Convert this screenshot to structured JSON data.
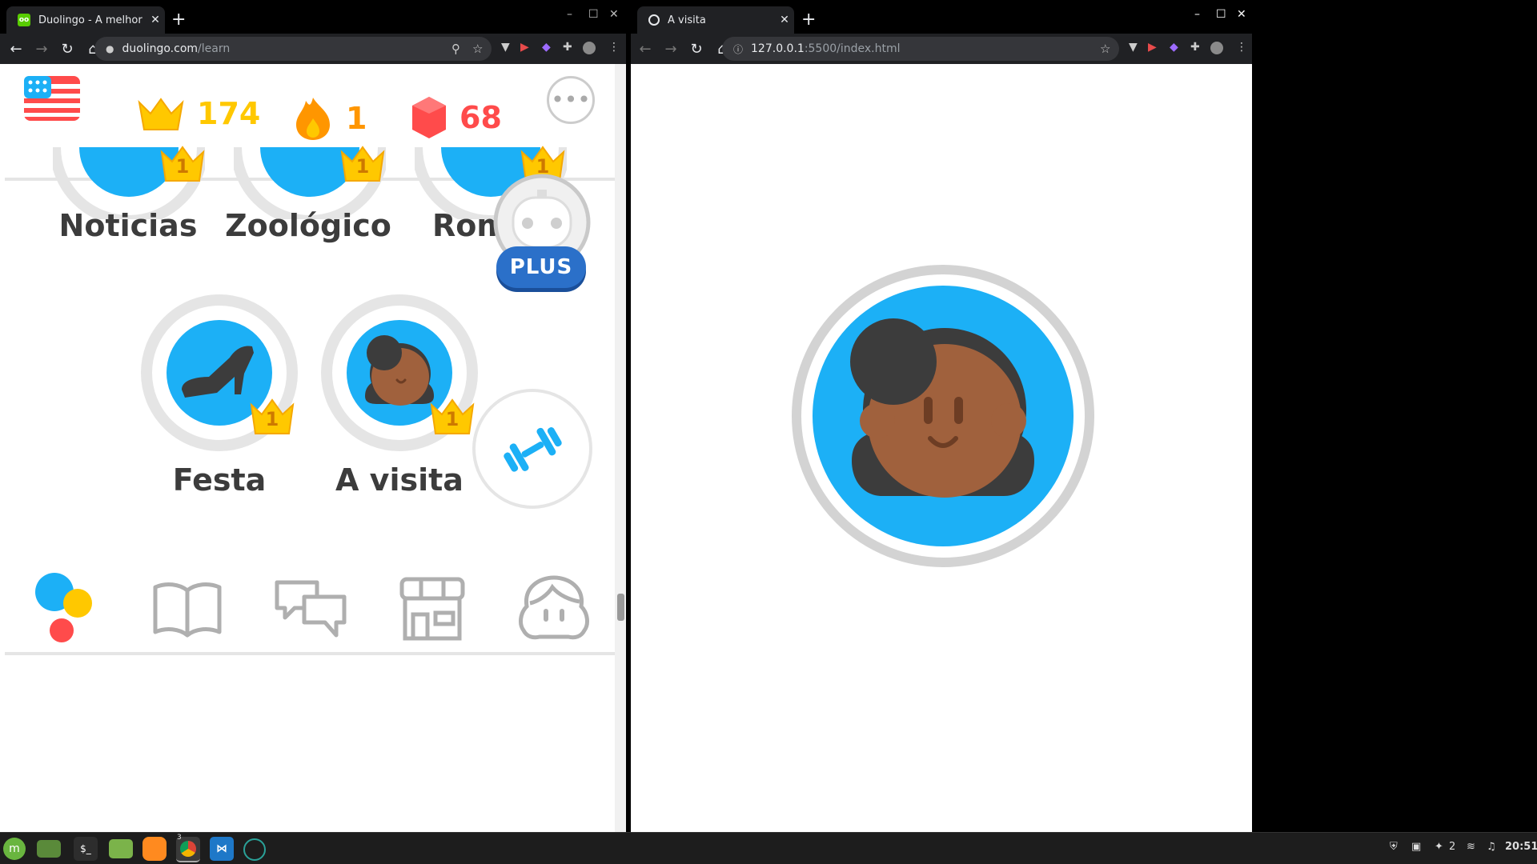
{
  "left_window": {
    "tab_title": "Duolingo - A melhor maneira de aprender um idioma",
    "url_host": "duolingo.com",
    "url_path": "/learn",
    "favicon": "owl-icon",
    "new_tab": "+",
    "tab_close": "✕",
    "window_controls": [
      "–",
      "☐",
      "✕"
    ]
  },
  "right_window": {
    "tab_title": "A visita",
    "url_host": "127.0.0.1",
    "url_path": ":5500/index.html",
    "new_tab": "+",
    "tab_close": "✕",
    "window_controls": [
      "–",
      "☐",
      "✕"
    ]
  },
  "nav_icons": {
    "back": "←",
    "forward": "→",
    "reload": "↻",
    "home": "⌂",
    "menu": "⋮",
    "zoom": "⚲",
    "star": "☆",
    "info": "ⓘ",
    "lock": "🔒"
  },
  "duolingo": {
    "flag": "us-flag-icon",
    "crowns": "174",
    "streak": "1",
    "gems": "68",
    "more": "more-icon",
    "skills_top": [
      {
        "name": "Noticias",
        "level": "1"
      },
      {
        "name": "Zoológico",
        "level": "1"
      },
      {
        "name": "Roma",
        "level": "1"
      }
    ],
    "skills_bottom": [
      {
        "name": "Festa",
        "level": "1"
      },
      {
        "name": "A visita",
        "level": "1"
      }
    ],
    "plus_label": "PLUS",
    "bottom_nav": [
      "learn-icon",
      "stories-icon",
      "discuss-icon",
      "shop-icon",
      "profile-icon"
    ]
  },
  "colors": {
    "blue": "#1cb0f6",
    "gold": "#ffc800",
    "orange": "#ff9600",
    "red": "#ff4b4b",
    "gray": "#e5e5e5"
  },
  "taskbar": {
    "workspace_badge": "3",
    "notifications": "2",
    "clock": "20:51"
  }
}
